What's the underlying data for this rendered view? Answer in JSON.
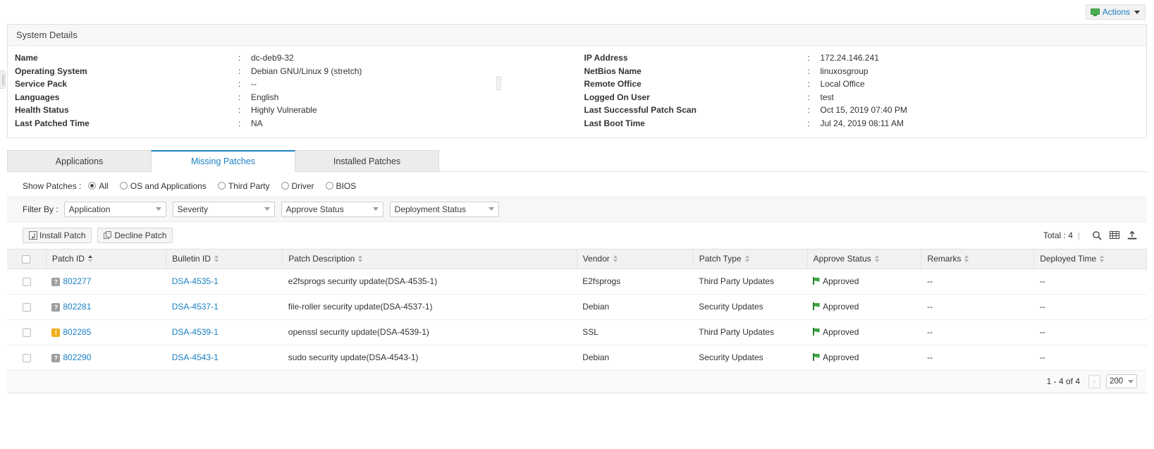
{
  "topbar": {
    "actions_label": "Actions",
    "monitor_icon": "monitor-icon",
    "caret_icon": "chevron-down-icon"
  },
  "system_details": {
    "title": "System Details",
    "left": [
      {
        "label": "Name",
        "value": "dc-deb9-32"
      },
      {
        "label": "Operating System",
        "value": "Debian GNU/Linux 9 (stretch)"
      },
      {
        "label": "Service Pack",
        "value": "--"
      },
      {
        "label": "Languages",
        "value": "English"
      },
      {
        "label": "Health Status",
        "value": "Highly Vulnerable"
      },
      {
        "label": "Last Patched Time",
        "value": "NA"
      }
    ],
    "right": [
      {
        "label": "IP Address",
        "value": "172.24.146.241"
      },
      {
        "label": "NetBios Name",
        "value": "linuxosgroup"
      },
      {
        "label": "Remote Office",
        "value": "Local Office"
      },
      {
        "label": "Logged On User",
        "value": "test"
      },
      {
        "label": "Last Successful Patch Scan",
        "value": "Oct 15, 2019 07:40 PM"
      },
      {
        "label": "Last Boot Time",
        "value": "Jul 24, 2019 08:11 AM"
      }
    ],
    "colon": ":"
  },
  "tabs": [
    {
      "label": "Applications",
      "active": false
    },
    {
      "label": "Missing Patches",
      "active": true
    },
    {
      "label": "Installed Patches",
      "active": false
    }
  ],
  "show_patches": {
    "label": "Show Patches :",
    "options": [
      {
        "label": "All",
        "checked": true
      },
      {
        "label": "OS and Applications",
        "checked": false
      },
      {
        "label": "Third Party",
        "checked": false
      },
      {
        "label": "Driver",
        "checked": false
      },
      {
        "label": "BIOS",
        "checked": false
      }
    ]
  },
  "filter_bar": {
    "label": "Filter By :",
    "selects": [
      {
        "value": "Application"
      },
      {
        "value": "Severity"
      },
      {
        "value": "Approve Status"
      },
      {
        "value": "Deployment Status"
      }
    ]
  },
  "action_bar": {
    "install_patch": "Install Patch",
    "decline_patch": "Decline Patch",
    "total_label": "Total : 4",
    "divider": "|",
    "icons": [
      "search-icon",
      "column-chooser-icon",
      "export-icon"
    ]
  },
  "table": {
    "columns": [
      {
        "label": "Patch ID",
        "sorted": true
      },
      {
        "label": "Bulletin ID",
        "sorted": false
      },
      {
        "label": "Patch Description",
        "sorted": false
      },
      {
        "label": "Vendor",
        "sorted": false
      },
      {
        "label": "Patch Type",
        "sorted": false
      },
      {
        "label": "Approve Status",
        "sorted": false
      },
      {
        "label": "Remarks",
        "sorted": false
      },
      {
        "label": "Deployed Time",
        "sorted": false
      }
    ],
    "rows": [
      {
        "severity": "unknown",
        "severity_glyph": "?",
        "patch_id": "802277",
        "bulletin_id": "DSA-4535-1",
        "description": "e2fsprogs security update(DSA-4535-1)",
        "vendor": "E2fsprogs",
        "patch_type": "Third Party Updates",
        "approve_status": "Approved",
        "remarks": "--",
        "deployed_time": "--"
      },
      {
        "severity": "unknown",
        "severity_glyph": "?",
        "patch_id": "802281",
        "bulletin_id": "DSA-4537-1",
        "description": "file-roller security update(DSA-4537-1)",
        "vendor": "Debian",
        "patch_type": "Security Updates",
        "approve_status": "Approved",
        "remarks": "--",
        "deployed_time": "--"
      },
      {
        "severity": "important",
        "severity_glyph": "!",
        "patch_id": "802285",
        "bulletin_id": "DSA-4539-1",
        "description": "openssl security update(DSA-4539-1)",
        "vendor": "SSL",
        "patch_type": "Third Party Updates",
        "approve_status": "Approved",
        "remarks": "--",
        "deployed_time": "--"
      },
      {
        "severity": "unknown",
        "severity_glyph": "?",
        "patch_id": "802290",
        "bulletin_id": "DSA-4543-1",
        "description": "sudo security update(DSA-4543-1)",
        "vendor": "Debian",
        "patch_type": "Security Updates",
        "approve_status": "Approved",
        "remarks": "--",
        "deployed_time": "--"
      }
    ]
  },
  "pager": {
    "range": "1 - 4 of 4",
    "prev_glyph": "‹",
    "page_size": "200"
  },
  "colors": {
    "accent": "#1a80c4",
    "approved_green": "#3aa540",
    "severity_unknown": "#9e9e9e",
    "severity_important": "#f0ad1e"
  }
}
